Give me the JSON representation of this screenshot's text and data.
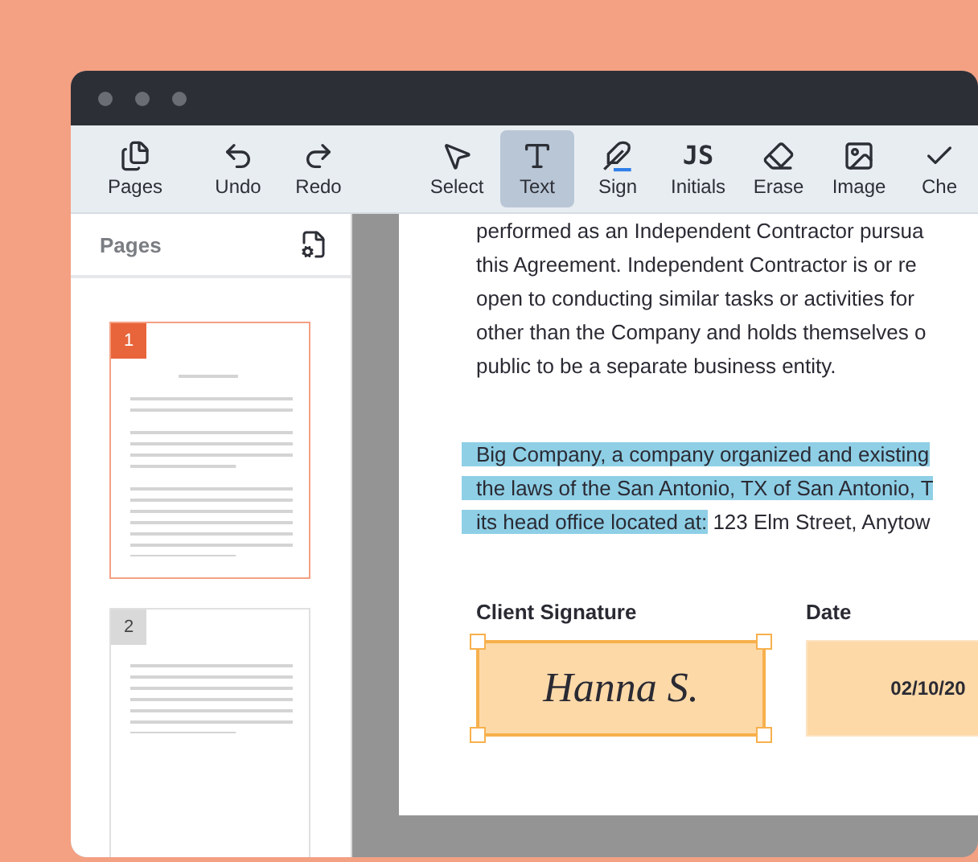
{
  "toolbar": {
    "groups": [
      [
        {
          "kind": "icon",
          "label": "Pages",
          "selected": false
        }
      ],
      [
        {
          "kind": "icon",
          "label": "Undo",
          "selected": false
        },
        {
          "kind": "icon",
          "label": "Redo",
          "selected": false
        }
      ],
      [
        {
          "kind": "icon",
          "label": "Select",
          "selected": false
        },
        {
          "kind": "icon",
          "label": "Text",
          "selected": true
        },
        {
          "kind": "icon",
          "label": "Sign",
          "selected": false
        },
        {
          "kind": "glyph",
          "glyph": "JS",
          "label": "Initials",
          "selected": false
        },
        {
          "kind": "icon",
          "label": "Erase",
          "selected": false
        },
        {
          "kind": "icon",
          "label": "Image",
          "selected": false
        },
        {
          "kind": "icon",
          "label": "Che",
          "selected": false
        }
      ]
    ]
  },
  "sidebar": {
    "title": "Pages",
    "pages": [
      {
        "number": "1",
        "selected": true
      },
      {
        "number": "2",
        "selected": false
      }
    ]
  },
  "document": {
    "paragraphs": [
      [
        [
          {
            "text": "performed as an Independent Contractor pursua",
            "highlighted": false
          }
        ],
        [
          {
            "text": "this Agreement. Independent Contractor is or re",
            "highlighted": false
          }
        ],
        [
          {
            "text": "open to conducting similar tasks or activities for",
            "highlighted": false
          }
        ],
        [
          {
            "text": "other than the Company and holds themselves o",
            "highlighted": false
          }
        ],
        [
          {
            "text": "public to be a separate business entity.",
            "highlighted": false
          }
        ]
      ],
      [
        [
          {
            "text": "Big Company, a company organized and existing",
            "highlighted": true
          }
        ],
        [
          {
            "text": "the laws of the San Antonio, TX of San Antonio, T",
            "highlighted": true
          }
        ],
        [
          {
            "text": "its head office located at:",
            "highlighted": true
          },
          {
            "text": " 123 Elm Street, Anytow",
            "highlighted": false
          }
        ]
      ]
    ],
    "fields": [
      {
        "kind": "signature",
        "label": "Client Signature",
        "value": "Hanna S.",
        "selected": true
      },
      {
        "kind": "date",
        "label": "Date",
        "value": "02/10/20",
        "selected": false
      }
    ]
  }
}
